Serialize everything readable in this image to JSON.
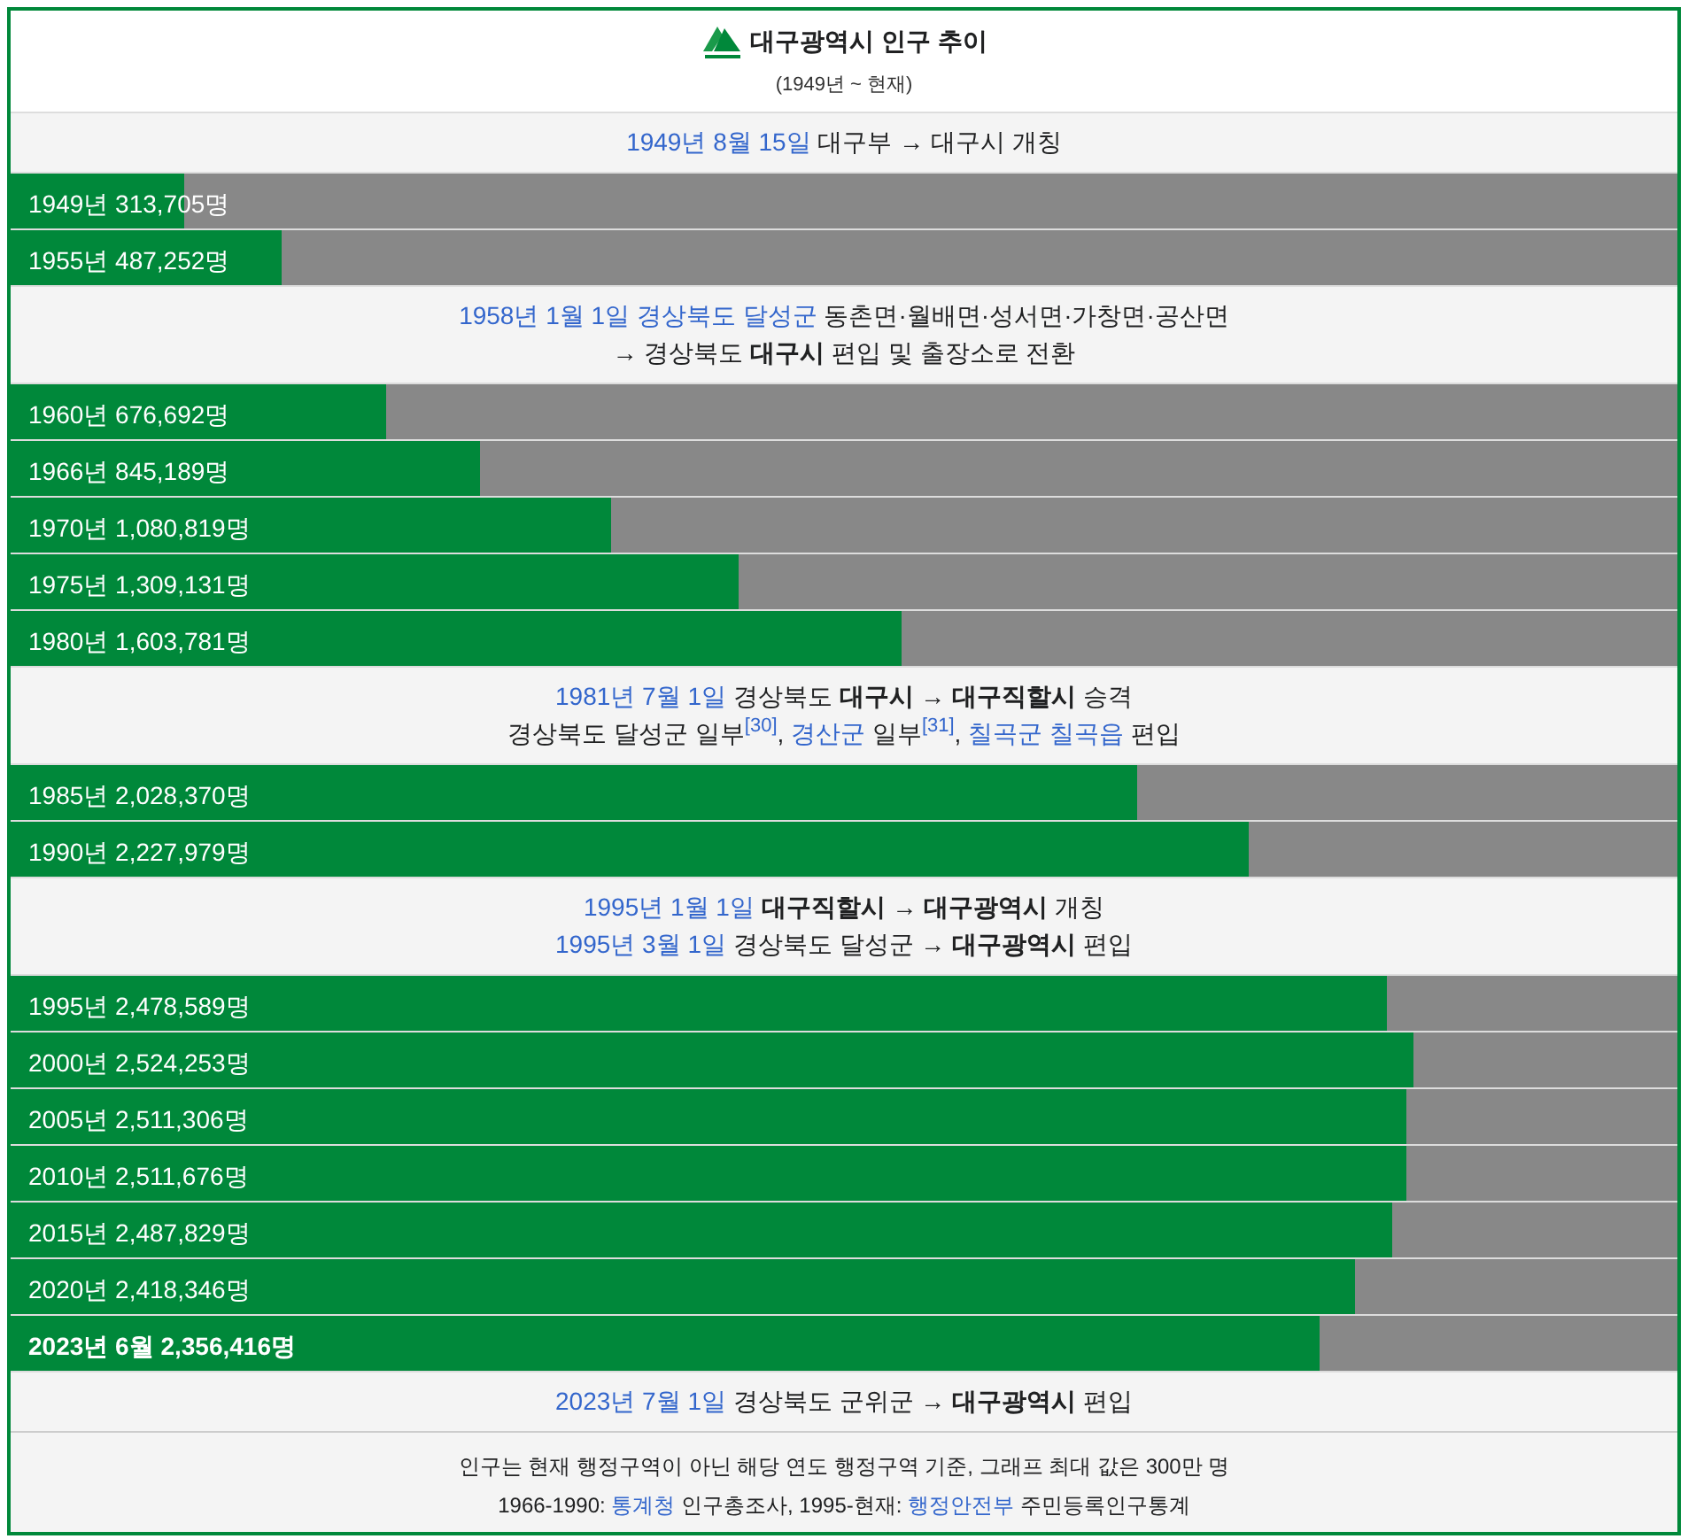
{
  "title": "대구광역시 인구 추이",
  "subtitle": "(1949년 ~ 현재)",
  "rows": [
    {
      "kind": "event",
      "lines": [
        [
          {
            "kind": "link",
            "text": "1949년 8월 15일"
          },
          {
            "kind": "plain",
            "text": " 대구부 → 대구시 개칭"
          }
        ]
      ]
    },
    {
      "kind": "bar",
      "label": "1949년 313,705명",
      "level": 0.1046,
      "bold": false
    },
    {
      "kind": "bar",
      "label": "1955년 487,252명",
      "level": 0.1624,
      "bold": false
    },
    {
      "kind": "event",
      "lines": [
        [
          {
            "kind": "link",
            "text": "1958년 1월 1일"
          },
          {
            "kind": "space"
          },
          {
            "kind": "link",
            "text": "경상북도 달성군"
          },
          {
            "kind": "plain",
            "text": " 동촌면·월배면·성서면·가창면·공산면"
          }
        ],
        [
          {
            "kind": "plain",
            "text": "→ 경상북도 "
          },
          {
            "kind": "bold",
            "text": "대구시"
          },
          {
            "kind": "plain",
            "text": " 편입 및 출장소로 전환"
          }
        ]
      ]
    },
    {
      "kind": "bar",
      "label": "1960년 676,692명",
      "level": 0.2256,
      "bold": false
    },
    {
      "kind": "bar",
      "label": "1966년 845,189명",
      "level": 0.2817,
      "bold": false
    },
    {
      "kind": "bar",
      "label": "1970년 1,080,819명",
      "level": 0.3603,
      "bold": false
    },
    {
      "kind": "bar",
      "label": "1975년 1,309,131명",
      "level": 0.4364,
      "bold": false
    },
    {
      "kind": "bar",
      "label": "1980년 1,603,781명",
      "level": 0.5346,
      "bold": false
    },
    {
      "kind": "event",
      "lines": [
        [
          {
            "kind": "link",
            "text": "1981년 7월 1일"
          },
          {
            "kind": "plain",
            "text": " 경상북도 "
          },
          {
            "kind": "bold",
            "text": "대구시"
          },
          {
            "kind": "plain",
            "text": " → "
          },
          {
            "kind": "bold",
            "text": "대구직할시"
          },
          {
            "kind": "plain",
            "text": " 승격"
          }
        ],
        [
          {
            "kind": "plain",
            "text": "경상북도 달성군 일부"
          },
          {
            "kind": "ref",
            "text": "[30]"
          },
          {
            "kind": "plain",
            "text": ", "
          },
          {
            "kind": "link",
            "text": "경산군"
          },
          {
            "kind": "plain",
            "text": " 일부"
          },
          {
            "kind": "ref",
            "text": "[31]"
          },
          {
            "kind": "plain",
            "text": ", "
          },
          {
            "kind": "link",
            "text": "칠곡군 칠곡읍"
          },
          {
            "kind": "plain",
            "text": " 편입"
          }
        ]
      ]
    },
    {
      "kind": "bar",
      "label": "1985년 2,028,370명",
      "level": 0.6761,
      "bold": false
    },
    {
      "kind": "bar",
      "label": "1990년 2,227,979명",
      "level": 0.7427,
      "bold": false
    },
    {
      "kind": "event",
      "lines": [
        [
          {
            "kind": "link",
            "text": "1995년 1월 1일"
          },
          {
            "kind": "space"
          },
          {
            "kind": "bold",
            "text": "대구직할시"
          },
          {
            "kind": "plain",
            "text": " → "
          },
          {
            "kind": "bold",
            "text": "대구광역시"
          },
          {
            "kind": "plain",
            "text": " 개칭"
          }
        ],
        [
          {
            "kind": "link",
            "text": "1995년 3월 1일"
          },
          {
            "kind": "plain",
            "text": " 경상북도 달성군 → "
          },
          {
            "kind": "bold",
            "text": "대구광역시"
          },
          {
            "kind": "plain",
            "text": " 편입"
          }
        ]
      ]
    },
    {
      "kind": "bar",
      "label": "1995년 2,478,589명",
      "level": 0.8262,
      "bold": false
    },
    {
      "kind": "bar",
      "label": "2000년 2,524,253명",
      "level": 0.8414,
      "bold": false
    },
    {
      "kind": "bar",
      "label": "2005년 2,511,306명",
      "level": 0.8371,
      "bold": false
    },
    {
      "kind": "bar",
      "label": "2010년 2,511,676명",
      "level": 0.8372,
      "bold": false
    },
    {
      "kind": "bar",
      "label": "2015년 2,487,829명",
      "level": 0.8293,
      "bold": false
    },
    {
      "kind": "bar",
      "label": "2020년 2,418,346명",
      "level": 0.8061,
      "bold": false
    },
    {
      "kind": "bar",
      "label": "2023년 6월 2,356,416명",
      "level": 0.7855,
      "bold": true
    },
    {
      "kind": "event",
      "lines": [
        [
          {
            "kind": "link",
            "text": "2023년 7월 1일"
          },
          {
            "kind": "plain",
            "text": " 경상북도 군위군 → "
          },
          {
            "kind": "bold",
            "text": "대구광역시"
          },
          {
            "kind": "plain",
            "text": " 편입"
          }
        ]
      ]
    }
  ],
  "footer": [
    [
      {
        "kind": "plain",
        "text": "인구는 현재 행정구역이 아닌 해당 연도 행정구역 기준, 그래프 최대 값은 300만 명"
      }
    ],
    [
      {
        "kind": "plain",
        "text": "1966-1990: "
      },
      {
        "kind": "link",
        "text": "통계청"
      },
      {
        "kind": "plain",
        "text": " 인구총조사, 1995-현재: "
      },
      {
        "kind": "link",
        "text": "행정안전부"
      },
      {
        "kind": "plain",
        "text": " 주민등록인구통계"
      }
    ]
  ]
}
